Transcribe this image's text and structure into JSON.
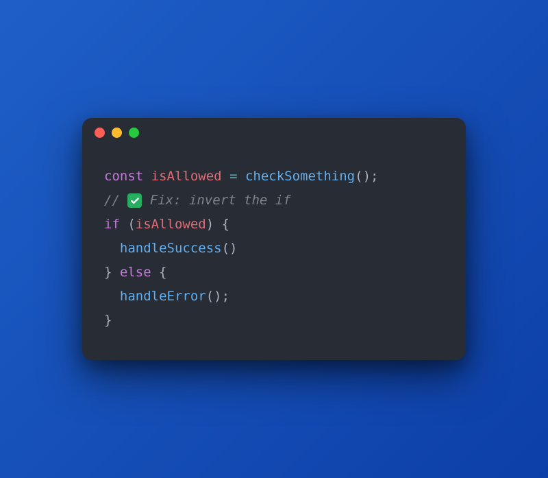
{
  "traffic_lights": [
    "red",
    "yellow",
    "green"
  ],
  "code": {
    "line1": {
      "kw": "const",
      "var": "isAllowed",
      "op": "=",
      "fn": "checkSomething",
      "call": "();"
    },
    "line2": {
      "prefix": "// ",
      "icon": "check",
      "text": " Fix: invert the if"
    },
    "line3": {
      "kw": "if",
      "open": " (",
      "var": "isAllowed",
      "close": ") {"
    },
    "line4": {
      "indent": "  ",
      "fn": "handleSuccess",
      "call": "()"
    },
    "line5": {
      "close": "} ",
      "kw": "else",
      "open": " {"
    },
    "line6": {
      "indent": "  ",
      "fn": "handleError",
      "call": "();"
    },
    "line7": {
      "close": "}"
    }
  }
}
